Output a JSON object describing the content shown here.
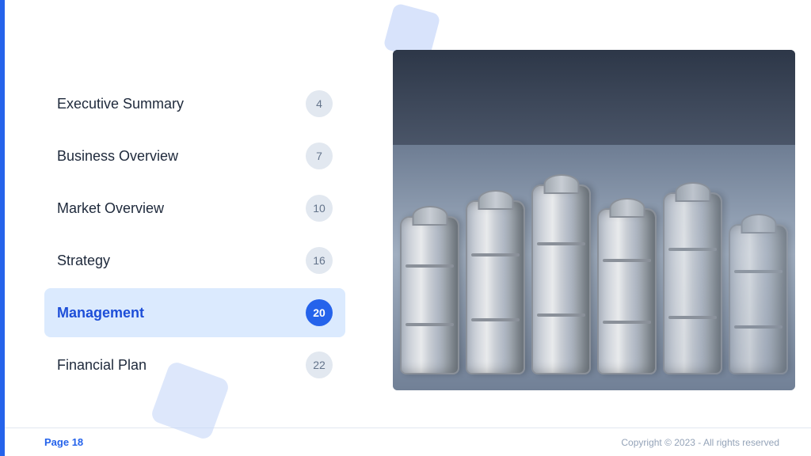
{
  "left_bar": {},
  "toc": {
    "items": [
      {
        "id": "executive-summary",
        "label": "Executive Summary",
        "page": "4",
        "active": false
      },
      {
        "id": "business-overview",
        "label": "Business Overview",
        "page": "7",
        "active": false
      },
      {
        "id": "market-overview",
        "label": "Market Overview",
        "page": "10",
        "active": false
      },
      {
        "id": "strategy",
        "label": "Strategy",
        "page": "16",
        "active": false
      },
      {
        "id": "management",
        "label": "Management",
        "page": "20",
        "active": true
      },
      {
        "id": "financial-plan",
        "label": "Financial Plan",
        "page": "22",
        "active": false
      }
    ]
  },
  "footer": {
    "page_label": "Page ",
    "page_number": "18",
    "copyright": "Copyright © 2023 - All rights reserved"
  },
  "image_alt": "Beer kegs in a brewery warehouse",
  "colors": {
    "accent": "#2563eb",
    "active_bg": "#dbeafe",
    "deco": "#c7d7f9"
  }
}
